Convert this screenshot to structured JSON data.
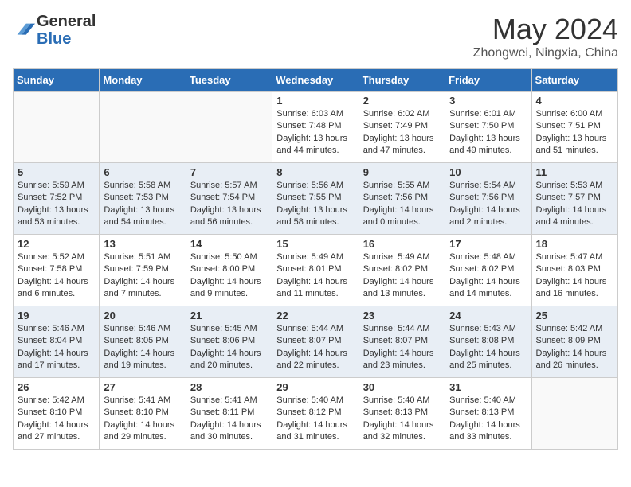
{
  "header": {
    "logo_general": "General",
    "logo_blue": "Blue",
    "month_year": "May 2024",
    "location": "Zhongwei, Ningxia, China"
  },
  "weekdays": [
    "Sunday",
    "Monday",
    "Tuesday",
    "Wednesday",
    "Thursday",
    "Friday",
    "Saturday"
  ],
  "weeks": [
    [
      {
        "day": "",
        "info": ""
      },
      {
        "day": "",
        "info": ""
      },
      {
        "day": "",
        "info": ""
      },
      {
        "day": "1",
        "info": "Sunrise: 6:03 AM\nSunset: 7:48 PM\nDaylight: 13 hours\nand 44 minutes."
      },
      {
        "day": "2",
        "info": "Sunrise: 6:02 AM\nSunset: 7:49 PM\nDaylight: 13 hours\nand 47 minutes."
      },
      {
        "day": "3",
        "info": "Sunrise: 6:01 AM\nSunset: 7:50 PM\nDaylight: 13 hours\nand 49 minutes."
      },
      {
        "day": "4",
        "info": "Sunrise: 6:00 AM\nSunset: 7:51 PM\nDaylight: 13 hours\nand 51 minutes."
      }
    ],
    [
      {
        "day": "5",
        "info": "Sunrise: 5:59 AM\nSunset: 7:52 PM\nDaylight: 13 hours\nand 53 minutes."
      },
      {
        "day": "6",
        "info": "Sunrise: 5:58 AM\nSunset: 7:53 PM\nDaylight: 13 hours\nand 54 minutes."
      },
      {
        "day": "7",
        "info": "Sunrise: 5:57 AM\nSunset: 7:54 PM\nDaylight: 13 hours\nand 56 minutes."
      },
      {
        "day": "8",
        "info": "Sunrise: 5:56 AM\nSunset: 7:55 PM\nDaylight: 13 hours\nand 58 minutes."
      },
      {
        "day": "9",
        "info": "Sunrise: 5:55 AM\nSunset: 7:56 PM\nDaylight: 14 hours\nand 0 minutes."
      },
      {
        "day": "10",
        "info": "Sunrise: 5:54 AM\nSunset: 7:56 PM\nDaylight: 14 hours\nand 2 minutes."
      },
      {
        "day": "11",
        "info": "Sunrise: 5:53 AM\nSunset: 7:57 PM\nDaylight: 14 hours\nand 4 minutes."
      }
    ],
    [
      {
        "day": "12",
        "info": "Sunrise: 5:52 AM\nSunset: 7:58 PM\nDaylight: 14 hours\nand 6 minutes."
      },
      {
        "day": "13",
        "info": "Sunrise: 5:51 AM\nSunset: 7:59 PM\nDaylight: 14 hours\nand 7 minutes."
      },
      {
        "day": "14",
        "info": "Sunrise: 5:50 AM\nSunset: 8:00 PM\nDaylight: 14 hours\nand 9 minutes."
      },
      {
        "day": "15",
        "info": "Sunrise: 5:49 AM\nSunset: 8:01 PM\nDaylight: 14 hours\nand 11 minutes."
      },
      {
        "day": "16",
        "info": "Sunrise: 5:49 AM\nSunset: 8:02 PM\nDaylight: 14 hours\nand 13 minutes."
      },
      {
        "day": "17",
        "info": "Sunrise: 5:48 AM\nSunset: 8:02 PM\nDaylight: 14 hours\nand 14 minutes."
      },
      {
        "day": "18",
        "info": "Sunrise: 5:47 AM\nSunset: 8:03 PM\nDaylight: 14 hours\nand 16 minutes."
      }
    ],
    [
      {
        "day": "19",
        "info": "Sunrise: 5:46 AM\nSunset: 8:04 PM\nDaylight: 14 hours\nand 17 minutes."
      },
      {
        "day": "20",
        "info": "Sunrise: 5:46 AM\nSunset: 8:05 PM\nDaylight: 14 hours\nand 19 minutes."
      },
      {
        "day": "21",
        "info": "Sunrise: 5:45 AM\nSunset: 8:06 PM\nDaylight: 14 hours\nand 20 minutes."
      },
      {
        "day": "22",
        "info": "Sunrise: 5:44 AM\nSunset: 8:07 PM\nDaylight: 14 hours\nand 22 minutes."
      },
      {
        "day": "23",
        "info": "Sunrise: 5:44 AM\nSunset: 8:07 PM\nDaylight: 14 hours\nand 23 minutes."
      },
      {
        "day": "24",
        "info": "Sunrise: 5:43 AM\nSunset: 8:08 PM\nDaylight: 14 hours\nand 25 minutes."
      },
      {
        "day": "25",
        "info": "Sunrise: 5:42 AM\nSunset: 8:09 PM\nDaylight: 14 hours\nand 26 minutes."
      }
    ],
    [
      {
        "day": "26",
        "info": "Sunrise: 5:42 AM\nSunset: 8:10 PM\nDaylight: 14 hours\nand 27 minutes."
      },
      {
        "day": "27",
        "info": "Sunrise: 5:41 AM\nSunset: 8:10 PM\nDaylight: 14 hours\nand 29 minutes."
      },
      {
        "day": "28",
        "info": "Sunrise: 5:41 AM\nSunset: 8:11 PM\nDaylight: 14 hours\nand 30 minutes."
      },
      {
        "day": "29",
        "info": "Sunrise: 5:40 AM\nSunset: 8:12 PM\nDaylight: 14 hours\nand 31 minutes."
      },
      {
        "day": "30",
        "info": "Sunrise: 5:40 AM\nSunset: 8:13 PM\nDaylight: 14 hours\nand 32 minutes."
      },
      {
        "day": "31",
        "info": "Sunrise: 5:40 AM\nSunset: 8:13 PM\nDaylight: 14 hours\nand 33 minutes."
      },
      {
        "day": "",
        "info": ""
      }
    ]
  ]
}
